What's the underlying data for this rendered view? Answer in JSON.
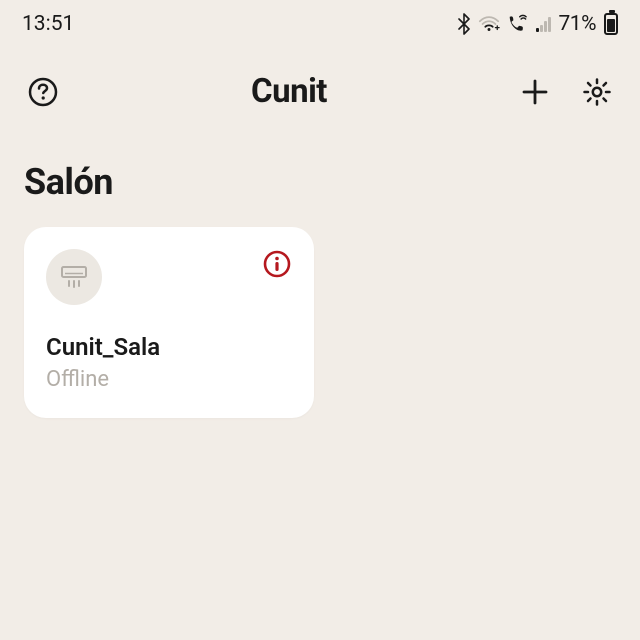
{
  "status_bar": {
    "time": "13:51",
    "battery_pct": "71%"
  },
  "header": {
    "title": "Cunit"
  },
  "section": {
    "title": "Salón"
  },
  "device": {
    "name": "Cunit_Sala",
    "status": "Offline"
  }
}
